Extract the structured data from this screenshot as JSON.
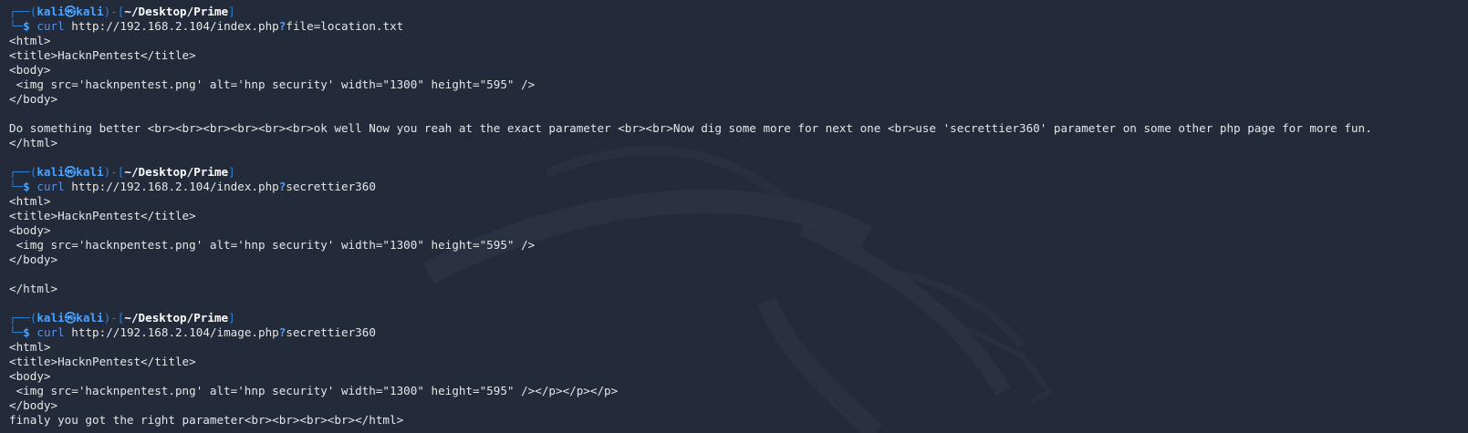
{
  "colors": {
    "background": "#232a3a",
    "prompt_frame": "#2a7fd4",
    "prompt_user": "#4aa3ff",
    "output_text": "#e6e6e6"
  },
  "prompt": {
    "frame_top": "┌──(",
    "user": "kali",
    "skull": "㉿",
    "host": "kali",
    "sep": ")-[",
    "path": "~/Desktop/Prime",
    "close": "]",
    "frame_bottom": "└─",
    "dollar": "$"
  },
  "blocks": [
    {
      "command": "curl",
      "url_before": "http://192.168.2.104/index.php",
      "url_q": "?",
      "url_after": "file=location.txt",
      "output": [
        "<html>",
        "<title>HacknPentest</title>",
        "<body>",
        " <img src='hacknpentest.png' alt='hnp security' width=\"1300\" height=\"595\" />",
        "</body>",
        "",
        "Do something better <br><br><br><br><br><br>ok well Now you reah at the exact parameter <br><br>Now dig some more for next one <br>use 'secrettier360' parameter on some other php page for more fun.",
        "</html>",
        ""
      ]
    },
    {
      "command": "curl",
      "url_before": "http://192.168.2.104/index.php",
      "url_q": "?",
      "url_after": "secrettier360",
      "output": [
        "<html>",
        "<title>HacknPentest</title>",
        "<body>",
        " <img src='hacknpentest.png' alt='hnp security' width=\"1300\" height=\"595\" />",
        "</body>",
        "",
        "</html>",
        ""
      ]
    },
    {
      "command": "curl",
      "url_before": "http://192.168.2.104/image.php",
      "url_q": "?",
      "url_after": "secrettier360",
      "output": [
        "<html>",
        "<title>HacknPentest</title>",
        "<body>",
        " <img src='hacknpentest.png' alt='hnp security' width=\"1300\" height=\"595\" /></p></p></p>",
        "</body>",
        "finaly you got the right parameter<br><br><br><br></html>"
      ]
    }
  ]
}
